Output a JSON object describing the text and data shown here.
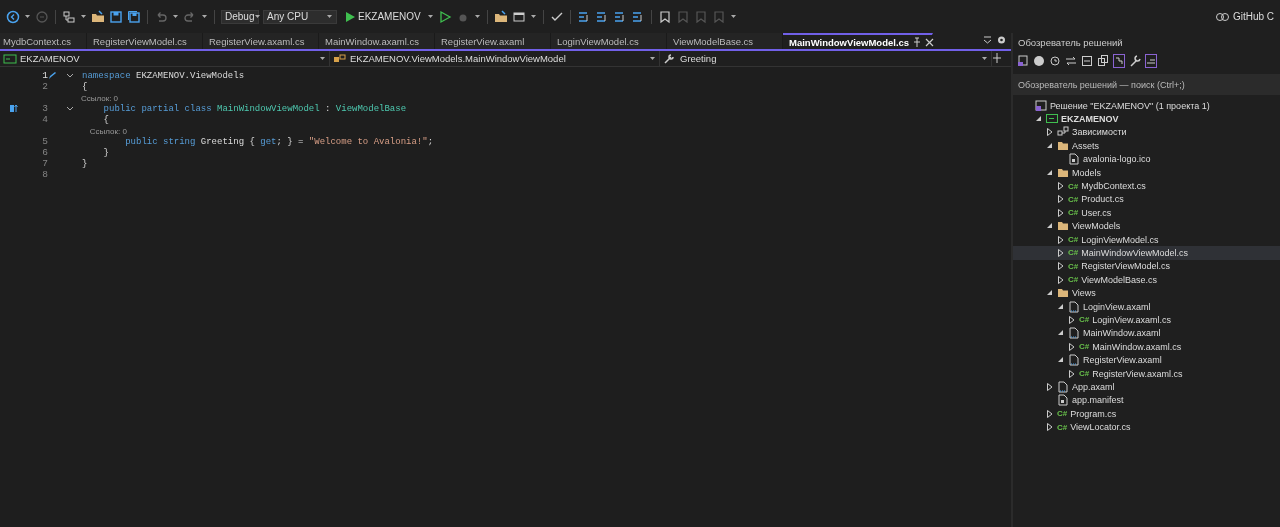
{
  "toolbar": {
    "config": "Debug",
    "platform": "Any CPU",
    "run_target": "EKZAMENOV",
    "account": "GitHub C"
  },
  "tabs": [
    {
      "label": "MydbContext.cs",
      "selected": false
    },
    {
      "label": "RegisterViewModel.cs",
      "selected": false
    },
    {
      "label": "RegisterView.axaml.cs",
      "selected": false
    },
    {
      "label": "MainWindow.axaml.cs",
      "selected": false
    },
    {
      "label": "RegisterView.axaml",
      "selected": false
    },
    {
      "label": "LoginViewModel.cs",
      "selected": false
    },
    {
      "label": "ViewModelBase.cs",
      "selected": false
    },
    {
      "label": "MainWindowViewModel.cs",
      "selected": true
    }
  ],
  "nav_bar": {
    "project": "EKZAMENOV",
    "type": "EKZAMENOV.ViewModels.MainWindowViewModel",
    "member": "Greeting"
  },
  "editor": {
    "lines": [
      {
        "kind": "code",
        "number": "1",
        "foldable": true,
        "edited": true,
        "overrides": false,
        "tokens": [
          {
            "kind": "kw",
            "s": "namespace"
          },
          {
            "kind": "plain",
            "s": " EKZAMENOV.ViewModels"
          }
        ]
      },
      {
        "kind": "code",
        "number": "2",
        "foldable": false,
        "edited": false,
        "overrides": false,
        "tokens": [
          {
            "kind": "plain",
            "s": "{"
          }
        ]
      },
      {
        "kind": "codelens",
        "text": "    Ссылок: 0"
      },
      {
        "kind": "code",
        "number": "3",
        "foldable": true,
        "edited": false,
        "overrides": true,
        "tokens": [
          {
            "kind": "kw",
            "s": "    public partial class"
          },
          {
            "kind": "type",
            "s": " MainWindowViewModel"
          },
          {
            "kind": "plain",
            "s": " : "
          },
          {
            "kind": "type",
            "s": "ViewModelBase"
          }
        ]
      },
      {
        "kind": "code",
        "number": "4",
        "foldable": false,
        "edited": false,
        "overrides": false,
        "tokens": [
          {
            "kind": "plain",
            "s": "    {"
          }
        ]
      },
      {
        "kind": "codelens",
        "text": "        Ссылок: 0"
      },
      {
        "kind": "code",
        "number": "5",
        "foldable": false,
        "edited": false,
        "overrides": false,
        "tokens": [
          {
            "kind": "kw",
            "s": "        public string"
          },
          {
            "kind": "plain",
            "s": " Greeting { "
          },
          {
            "kind": "kw",
            "s": "get"
          },
          {
            "kind": "plain",
            "s": "; } = "
          },
          {
            "kind": "str",
            "s": "\"Welcome to Avalonia!\""
          },
          {
            "kind": "plain",
            "s": ";"
          }
        ]
      },
      {
        "kind": "code",
        "number": "6",
        "foldable": false,
        "edited": false,
        "overrides": false,
        "tokens": [
          {
            "kind": "plain",
            "s": "    }"
          }
        ]
      },
      {
        "kind": "code",
        "number": "7",
        "foldable": false,
        "edited": false,
        "overrides": false,
        "tokens": [
          {
            "kind": "plain",
            "s": "}"
          }
        ]
      },
      {
        "kind": "code",
        "number": "8",
        "foldable": false,
        "edited": false,
        "overrides": false
      }
    ]
  },
  "solution_explorer": {
    "title": "Обозреватель решений",
    "search": {
      "placeholder": "Обозреватель решений — поиск (Ctrl+;)"
    },
    "tree": [
      {
        "kind": "solution",
        "label": "Решение \"EKZAMENOV\"  (1 проекта 1)",
        "selected": false,
        "children": [
          {
            "kind": "project",
            "label": "EKZAMENOV",
            "expanded": true,
            "selected": false,
            "children": [
              {
                "kind": "deps",
                "label": "Зависимости",
                "expanded": false,
                "selected": false
              },
              {
                "kind": "folder",
                "label": "Assets",
                "expanded": true,
                "selected": false,
                "children": [
                  {
                    "kind": "file",
                    "label": "avalonia-logo.ico",
                    "selected": false
                  }
                ]
              },
              {
                "kind": "folder",
                "label": "Models",
                "expanded": true,
                "selected": false,
                "children": [
                  {
                    "kind": "cs",
                    "badge": "C#",
                    "label": "MydbContext.cs",
                    "expanded": false,
                    "selected": false
                  },
                  {
                    "kind": "cs",
                    "badge": "C#",
                    "label": "Product.cs",
                    "expanded": false,
                    "selected": false
                  },
                  {
                    "kind": "cs",
                    "badge": "C#",
                    "label": "User.cs",
                    "expanded": false,
                    "selected": false
                  }
                ]
              },
              {
                "kind": "folder",
                "label": "ViewModels",
                "expanded": true,
                "selected": false,
                "children": [
                  {
                    "kind": "cs",
                    "badge": "C#",
                    "label": "LoginViewModel.cs",
                    "expanded": false,
                    "selected": false
                  },
                  {
                    "kind": "cs",
                    "badge": "C#",
                    "label": "MainWindowViewModel.cs",
                    "expanded": false,
                    "selected": true
                  },
                  {
                    "kind": "cs",
                    "badge": "C#",
                    "label": "RegisterViewModel.cs",
                    "expanded": false,
                    "selected": false
                  },
                  {
                    "kind": "cs",
                    "badge": "C#",
                    "label": "ViewModelBase.cs",
                    "expanded": false,
                    "selected": false
                  }
                ]
              },
              {
                "kind": "folder",
                "label": "Views",
                "expanded": true,
                "selected": false,
                "children": [
                  {
                    "kind": "xaml",
                    "label": "LoginView.axaml",
                    "expanded": true,
                    "selected": false,
                    "children": [
                      {
                        "kind": "cs",
                        "badge": "C#",
                        "label": "LoginView.axaml.cs",
                        "expanded": false,
                        "selected": false
                      }
                    ]
                  },
                  {
                    "kind": "xaml",
                    "label": "MainWindow.axaml",
                    "expanded": true,
                    "selected": false,
                    "children": [
                      {
                        "kind": "cs",
                        "badge": "C#",
                        "label": "MainWindow.axaml.cs",
                        "expanded": false,
                        "selected": false
                      }
                    ]
                  },
                  {
                    "kind": "xaml",
                    "label": "RegisterView.axaml",
                    "expanded": true,
                    "selected": false,
                    "children": [
                      {
                        "kind": "cs",
                        "badge": "C#",
                        "label": "RegisterView.axaml.cs",
                        "expanded": false,
                        "selected": false
                      }
                    ]
                  }
                ]
              },
              {
                "kind": "xaml",
                "label": "App.axaml",
                "expanded": false,
                "selected": false
              },
              {
                "kind": "file",
                "label": "app.manifest",
                "selected": false
              },
              {
                "kind": "cs",
                "badge": "C#",
                "label": "Program.cs",
                "expanded": false,
                "selected": false
              },
              {
                "kind": "cs",
                "badge": "C#",
                "label": "ViewLocator.cs",
                "expanded": false,
                "selected": false
              }
            ]
          }
        ]
      }
    ]
  }
}
